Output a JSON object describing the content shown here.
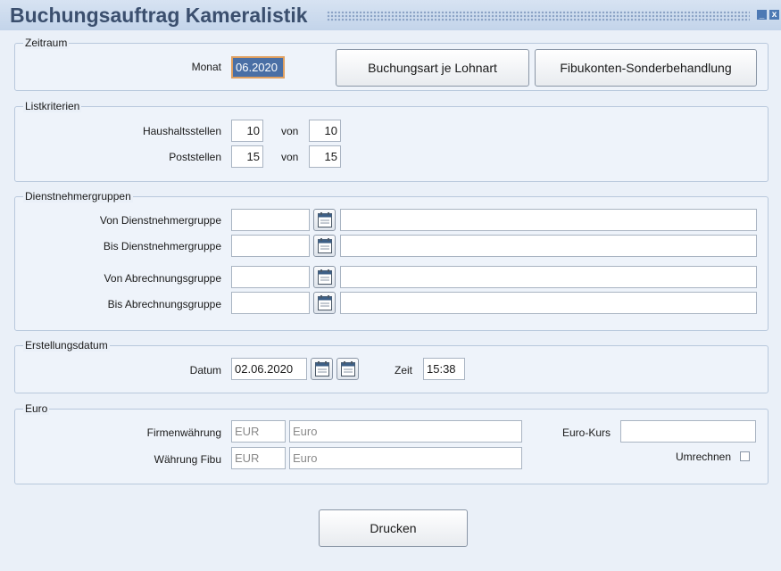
{
  "window": {
    "title": "Buchungsauftrag Kameralistik",
    "minimize": "_",
    "close": "x"
  },
  "zeitraum": {
    "legend": "Zeitraum",
    "monat_label": "Monat",
    "monat_value": "06.2020",
    "btn_buchungsart": "Buchungsart je Lohnart",
    "btn_fibukonten": "Fibukonten-Sonderbehandlung"
  },
  "listkriterien": {
    "legend": "Listkriterien",
    "haushalt_label": "Haushaltsstellen",
    "haushalt_from": "10",
    "von": "von",
    "haushalt_to": "10",
    "post_label": "Poststellen",
    "post_from": "15",
    "post_to": "15"
  },
  "dienstnehmer": {
    "legend": "Dienstnehmergruppen",
    "rows": [
      {
        "label": "Von Dienstnehmergruppe",
        "code": "",
        "text": ""
      },
      {
        "label": "Bis Dienstnehmergruppe",
        "code": "",
        "text": ""
      },
      {
        "label": "Von Abrechnungsgruppe",
        "code": "",
        "text": ""
      },
      {
        "label": "Bis Abrechnungsgruppe",
        "code": "",
        "text": ""
      }
    ]
  },
  "erstellung": {
    "legend": "Erstellungsdatum",
    "datum_label": "Datum",
    "datum_value": "02.06.2020",
    "zeit_label": "Zeit",
    "zeit_value": "15:38"
  },
  "euro": {
    "legend": "Euro",
    "firmen_label": "Firmenwährung",
    "firmen_code": "EUR",
    "firmen_name": "Euro",
    "fibu_label": "Währung Fibu",
    "fibu_code": "EUR",
    "fibu_name": "Euro",
    "kurs_label": "Euro-Kurs",
    "kurs_value": "",
    "umrechnen_label": "Umrechnen",
    "umrechnen_checked": false
  },
  "actions": {
    "drucken": "Drucken"
  }
}
